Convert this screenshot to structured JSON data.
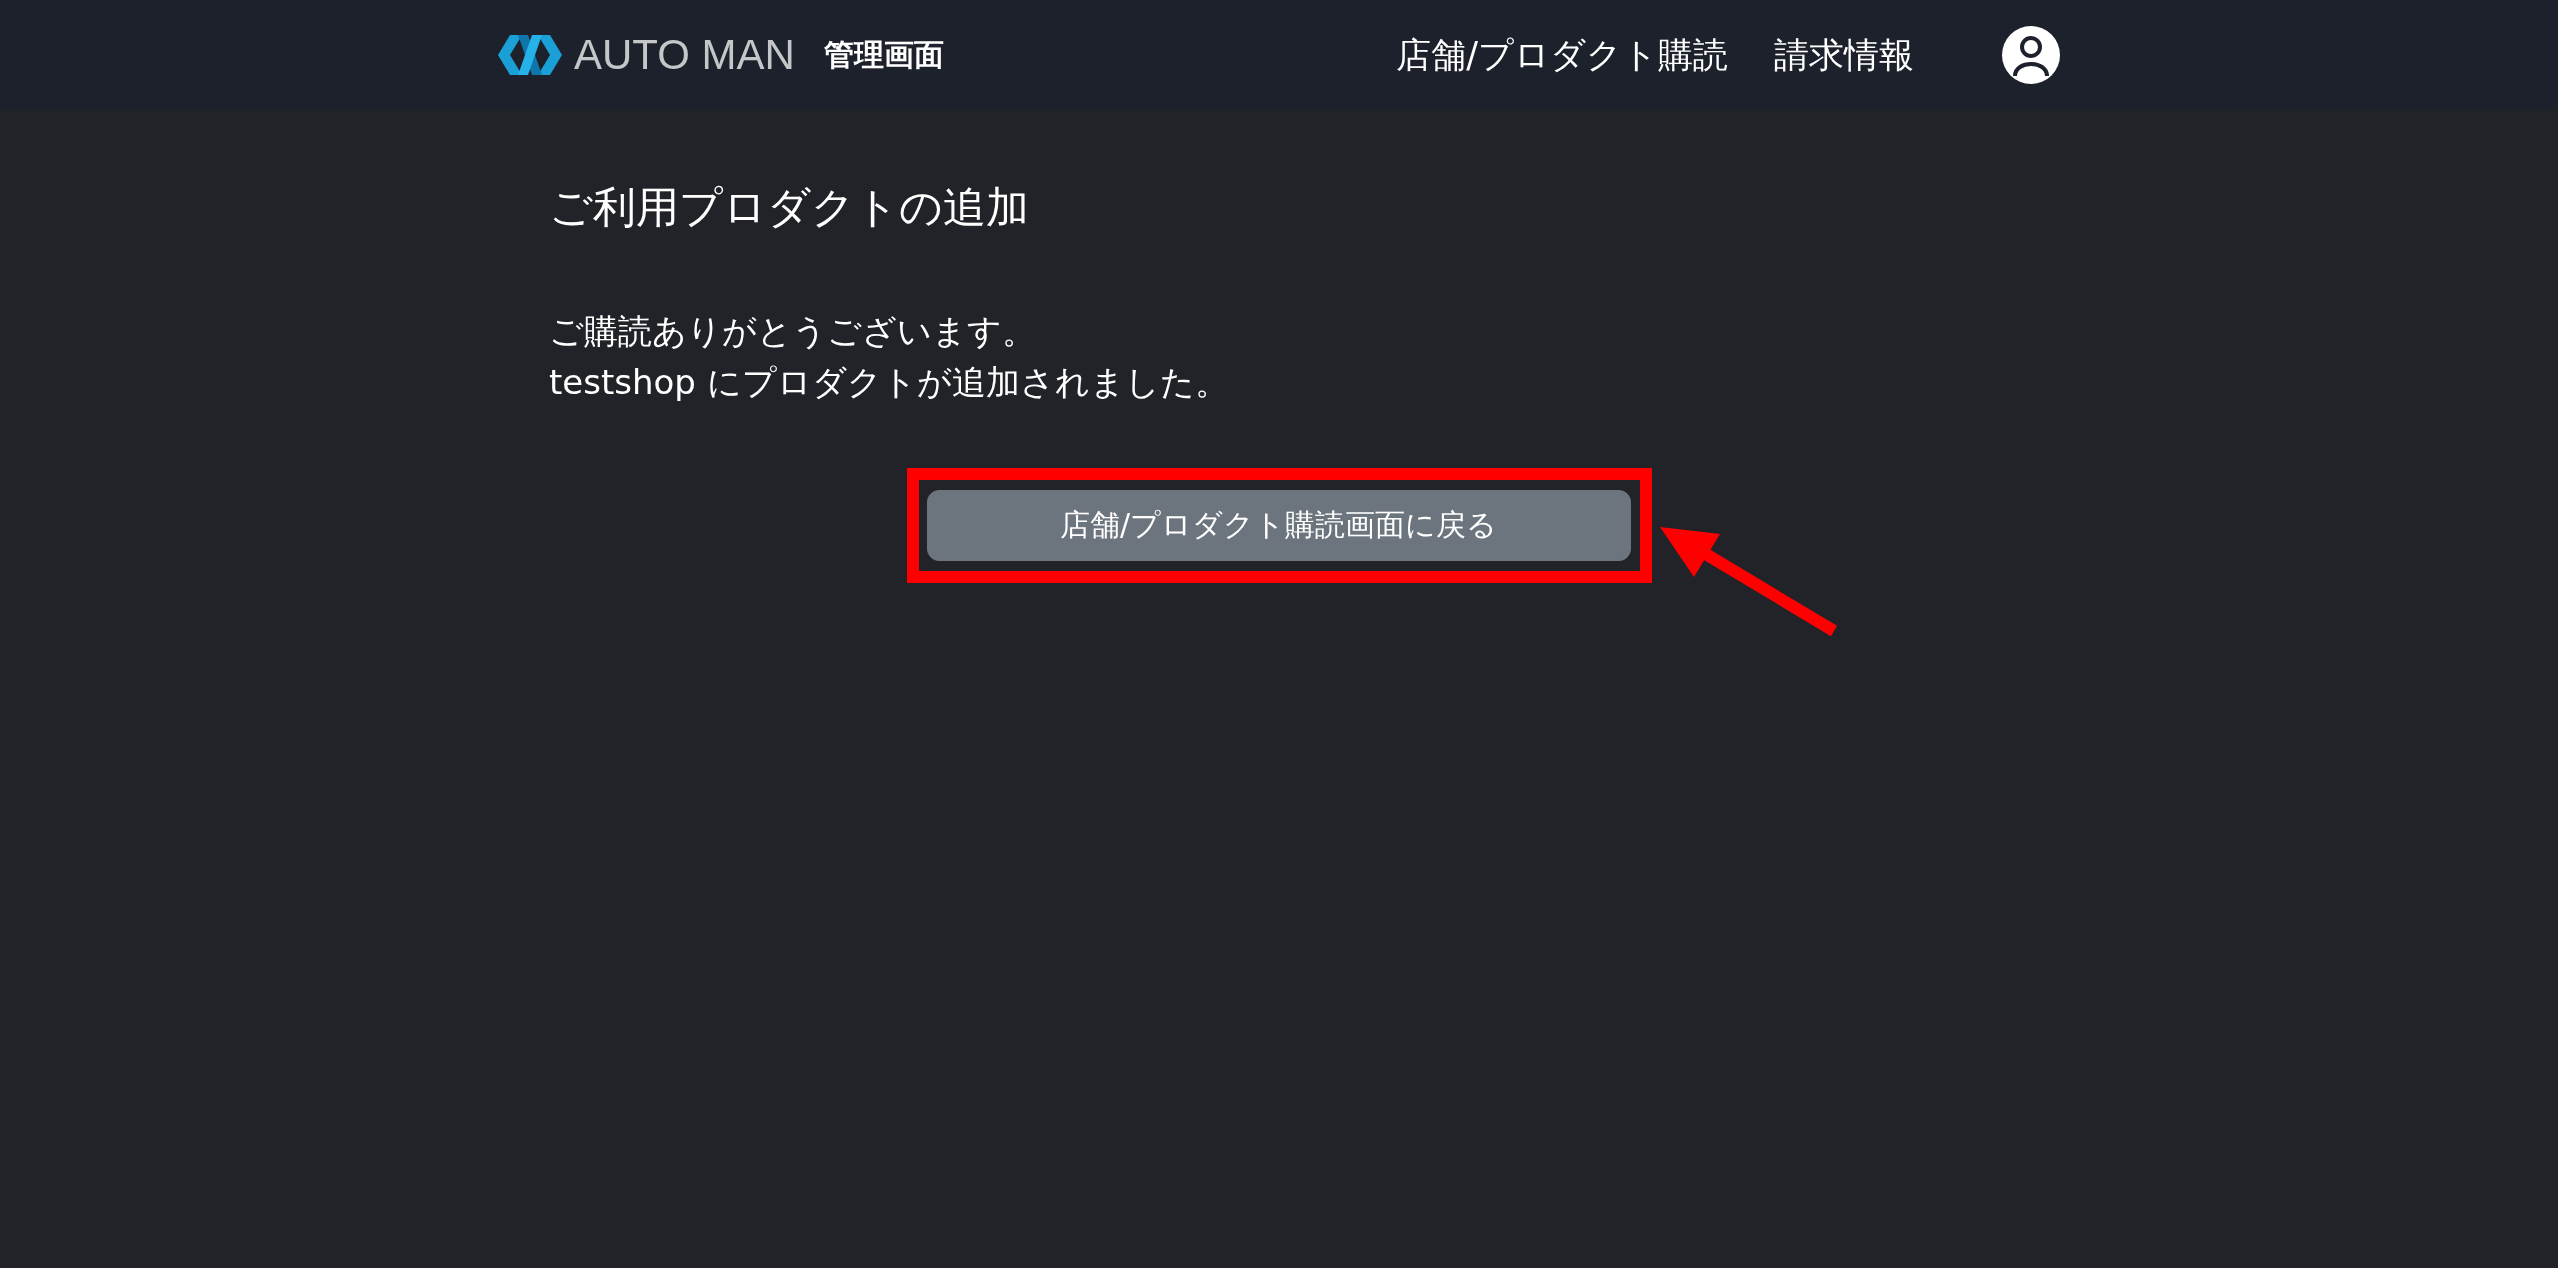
{
  "header": {
    "logo_text": "AUTO MAN",
    "subtitle": "管理画面",
    "nav": [
      "店舗/プロダクト購読",
      "請求情報"
    ]
  },
  "main": {
    "title": "ご利用プロダクトの追加",
    "message": [
      "ご購読ありがとうございます。",
      "testshop にプロダクトが追加されました。"
    ],
    "back_button": "店舗/プロダクト購読画面に戻る"
  }
}
